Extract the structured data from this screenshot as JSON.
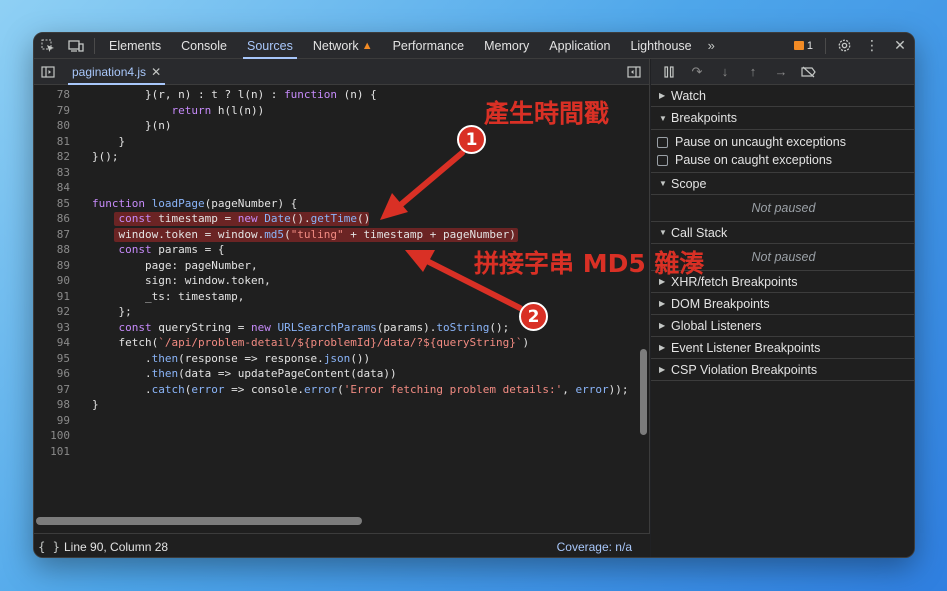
{
  "topbar": {
    "tabs": [
      "Elements",
      "Console",
      "Sources",
      "Network",
      "Performance",
      "Memory",
      "Application",
      "Lighthouse"
    ],
    "active_tab": "Sources",
    "issues_count": "1"
  },
  "editor": {
    "file_tab": "pagination4.js",
    "lines": [
      {
        "n": "78",
        "code": "        }(r, n) : t ? l(n) : function (n) {"
      },
      {
        "n": "79",
        "code": "            return h(l(n))"
      },
      {
        "n": "80",
        "code": "        }(n)"
      },
      {
        "n": "81",
        "code": "    }"
      },
      {
        "n": "82",
        "code": "}();"
      },
      {
        "n": "83",
        "code": ""
      },
      {
        "n": "84",
        "code": ""
      },
      {
        "n": "85",
        "code": "function loadPage(pageNumber) {"
      },
      {
        "n": "86",
        "code": "    const timestamp = new Date().getTime()"
      },
      {
        "n": "87",
        "code": "    window.token = window.md5(\"tuling\" + timestamp + pageNumber)"
      },
      {
        "n": "88",
        "code": "    const params = {"
      },
      {
        "n": "89",
        "code": "        page: pageNumber,"
      },
      {
        "n": "90",
        "code": "        sign: window.token,"
      },
      {
        "n": "91",
        "code": "        _ts: timestamp,"
      },
      {
        "n": "92",
        "code": "    };"
      },
      {
        "n": "93",
        "code": "    const queryString = new URLSearchParams(params).toString();"
      },
      {
        "n": "94",
        "code": "    fetch(`/api/problem-detail/${problemId}/data/?${queryString}`)"
      },
      {
        "n": "95",
        "code": "        .then(response => response.json())"
      },
      {
        "n": "96",
        "code": "        .then(data => updatePageContent(data))"
      },
      {
        "n": "97",
        "code": "        .catch(error => console.error('Error fetching problem details:', error));"
      },
      {
        "n": "98",
        "code": "}"
      },
      {
        "n": "99",
        "code": ""
      },
      {
        "n": "100",
        "code": ""
      },
      {
        "n": "101",
        "code": ""
      }
    ]
  },
  "status": {
    "position": "Line 90, Column 28",
    "coverage": "Coverage: n/a"
  },
  "debugger": {
    "watch": "Watch",
    "breakpoints": "Breakpoints",
    "pause_uncaught": "Pause on uncaught exceptions",
    "pause_caught": "Pause on caught exceptions",
    "scope": "Scope",
    "scope_status": "Not paused",
    "call_stack": "Call Stack",
    "call_stack_status": "Not paused",
    "collapsed_sections": [
      "XHR/fetch Breakpoints",
      "DOM Breakpoints",
      "Global Listeners",
      "Event Listener Breakpoints",
      "CSP Violation Breakpoints"
    ]
  },
  "annotations": {
    "label1": "產生時間戳",
    "label2": "拼接字串 MD5 雜湊",
    "badge1": "1",
    "badge2": "2",
    "color": "#d93025"
  }
}
